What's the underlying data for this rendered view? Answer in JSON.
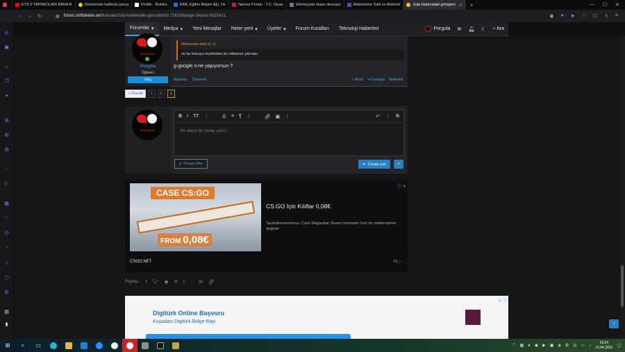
{
  "browser": {
    "tabs": [
      {
        "title": "",
        "color": "#e53935",
        "active": false
      },
      {
        "title": "ETS 2 YAPIMCILARI BANA B",
        "color": "#ff0000",
        "active": false
      },
      {
        "title": "Sisteminde kalitesiz parça",
        "color": "#f0c419",
        "active": false
      },
      {
        "title": "Profile - Roblox",
        "color": "#ffffff",
        "active": false
      },
      {
        "title": "EBA, Eğitim Bilişim Ağı, De",
        "color": "#1976d2",
        "active": false
      },
      {
        "title": "Namaz Portalı - T.C. Diyan",
        "color": "#c2185b",
        "active": false
      },
      {
        "title": "Ettehiyyatü duası okunuşu",
        "color": "#607d8b",
        "active": false
      },
      {
        "title": "Allahümme Salli ve Allahüm",
        "color": "#3f51b5",
        "active": false
      },
      {
        "title": "Zula hakkındaki görüşleri",
        "color": "#f0c419",
        "active": true
      }
    ],
    "new_tab": "+",
    "url_domain": "forum.shiftdelete.net",
    "url_path": "/konular/zula-hakkindaki-gorusleriniz.716236/page-3#post-5915411"
  },
  "nav": {
    "items": [
      "Forumlar",
      "Medya",
      "Yeni Mesajlar",
      "Neler yeni",
      "Üyeler",
      "Forum Kuralları",
      "Teknoloji Haberleri"
    ],
    "user": "Porgola",
    "search": "Ara"
  },
  "post": {
    "username": "Porgola",
    "user_title": "Öğrenci",
    "badge": "Güç",
    "avatar_text": "SYS GOLA",
    "quote_author": "efemurato dedi ki:",
    "quote_text": "ve bu konuyu incelerken bu reklamın çıkması",
    "message": "g-google n-ne yapıyorsun ?",
    "report": "Raporla",
    "edit": "Düzenle",
    "quote_action": "+ Alıntı",
    "reply_action": "Cevapla",
    "tag_action": "Etiketle"
  },
  "pagination": {
    "prev": "« Önceki",
    "pages": [
      "1",
      "2",
      "3"
    ],
    "current": "3"
  },
  "reply": {
    "placeholder": "Bu alana bir cevap yazın...",
    "attach": "Dosya ekle",
    "submit": "Cevap yaz"
  },
  "ad": {
    "img_headline": "CASE CS:GO",
    "img_price_prefix": "FROM ",
    "img_price": "0,08€",
    "title": "CS:GO İçin Kılıflar 0,08€",
    "description": "Taydellinenevimuus. Canlı Mağazalar Steam üzerinden hızlı bir yetkilendirme değildir!",
    "domain": "CSGO.NET",
    "open": "Aç"
  },
  "share": {
    "label": "Paylaş:"
  },
  "ad2": {
    "title": "Digitürk Online Başvuru",
    "subtitle": "Kuşadası Digitürk Bölge Bayi"
  },
  "taskbar": {
    "time": "16:24",
    "date": "12.04.2021"
  }
}
